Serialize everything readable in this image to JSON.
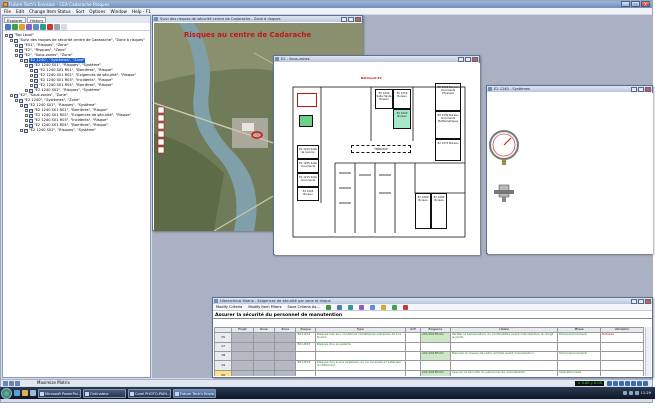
{
  "app": {
    "title": "Future Tech's Envision - CEA Cadarache Risques"
  },
  "window_controls": {
    "minimize": "_",
    "maximize": "□",
    "close": "X"
  },
  "menu": [
    "File",
    "Edit",
    "Change Item Status",
    "Sort",
    "Options",
    "Window",
    "Help - F1"
  ],
  "left_pane": {
    "tabs": [
      "Explorer",
      "History"
    ],
    "tree": [
      {
        "indent": 0,
        "text": "\"Top Level\""
      },
      {
        "indent": 1,
        "text": "\"Suivi des risques de sécurité centre de Cadarache\", \"Zone à risques\""
      },
      {
        "indent": 2,
        "text": "\"E01\", \"Risques\", \"Zone\""
      },
      {
        "indent": 2,
        "text": "\"E2\", \"Risques\", \"Zone\""
      },
      {
        "indent": 2,
        "text": "\"E2\", \"Sous-zones\", \"Zone\""
      },
      {
        "indent": 3,
        "text": "\"E2 1240\", \"Systèmes\", \"Zone\"",
        "selected": true
      },
      {
        "indent": 4,
        "text": "\"E2 1240 S01\", \"Risques\", \"Système\""
      },
      {
        "indent": 5,
        "text": "\"E2 1240 S01 R01\", \"Barrières\", \"Risque\""
      },
      {
        "indent": 5,
        "text": "\"E2 1240 S01 R02\", \"Exigences de sécurité\", \"Risque\""
      },
      {
        "indent": 5,
        "text": "\"E2 1240 S01 R03\", \"Incidents\", \"Risque\""
      },
      {
        "indent": 5,
        "text": "\"E2 1240 S01 R04\", \"Barrières\", \"Risque\""
      },
      {
        "indent": 4,
        "text": "\"E2 1240 S02\", \"Risques\", \"Système\""
      },
      {
        "indent": 1,
        "text": "\"E2\", \"Sous-zones\", \"Zone\""
      },
      {
        "indent": 2,
        "text": "\"E2 1240\", \"Systèmes\", \"Zone\""
      },
      {
        "indent": 3,
        "text": "\"E2 1240 S01\", \"Risques\", \"Système\""
      },
      {
        "indent": 4,
        "text": "\"E2 1240 S01 R01\", \"Barrières\", \"Risque\""
      },
      {
        "indent": 4,
        "text": "\"E2 1240 S01 R02\", \"Exigences de sécurité\", \"Risque\""
      },
      {
        "indent": 4,
        "text": "\"E2 1240 S01 R03\", \"Incidents\", \"Risque\""
      },
      {
        "indent": 4,
        "text": "\"E2 1240 S01 R04\", \"Barrières\", \"Risque\""
      },
      {
        "indent": 3,
        "text": "\"E2 1240 S02\", \"Risques\", \"Système\""
      }
    ]
  },
  "windows": {
    "aerial": {
      "title": "Suivi des risques de sécurité centre de Cadarache - Zone à risques",
      "overlay": "Risques au centre de Cadarache"
    },
    "plan": {
      "title": "E2 - Sous-zones",
      "label": "Bâtiment E2"
    },
    "systems": {
      "title": "E2 1240 - Systèmes"
    },
    "matrix": {
      "title": "Hierarchical Matrix - Exigences de sécurité par zone et risque",
      "toolbar": [
        "Modify Criteria",
        "Modify Item Filters",
        "Save Criteria As..."
      ],
      "heading": "Assurer la sécurité du personnel de manutention",
      "columns": [
        "",
        "Projet",
        "Zone",
        "Zone",
        "Risque",
        "Type",
        "GYP",
        "Exigence",
        "Libellé",
        "Phase",
        "Validation"
      ],
      "rows": [
        {
          "n": "15",
          "risque": "E01-R02",
          "type": "Risques liés aux conditions climatiques extrêmes et à la foudre",
          "gyp": "",
          "exig": "A01/2023Ex01",
          "lib": "Vérifier la température du combustible avant manutention au doigt je poids",
          "phase": "Dimensionnement",
          "valid": "Refusée"
        },
        {
          "n": "17",
          "risque": "E01-R03",
          "type": "Risques dus au séisme",
          "gyp": "",
          "exig": "",
          "lib": "",
          "phase": "",
          "valid": ""
        },
        {
          "n": "18",
          "risque": "",
          "type": "",
          "gyp": "",
          "exig": "A01/2023Ex01",
          "lib": "Mesurer le niveau de radio activité avant manutention",
          "phase": "Dimensionnement",
          "valid": ""
        },
        {
          "n": "19",
          "risque": "E01-R04",
          "type": "Risques dus à une explosion ou un incendie à l'extérieur du bâtiment",
          "gyp": "",
          "exig": "",
          "lib": "",
          "phase": "",
          "valid": ""
        },
        {
          "n": "20",
          "risque": "",
          "type": "",
          "gyp": "",
          "exig": "A01/2023Ex01",
          "lib": "Assurer la sécurité du personnel de manutention",
          "phase": "Opérationnelle",
          "valid": ""
        },
        {
          "n": "",
          "risque": "",
          "type": "",
          "gyp": "",
          "exig": "",
          "lib": "",
          "phase": "",
          "valid": ""
        },
        {
          "n": "21",
          "zone2": "E2 1240",
          "risque": "",
          "type": "",
          "gyp": "",
          "exig": "",
          "lib": "",
          "phase": "",
          "valid": ""
        }
      ]
    }
  },
  "plan_rooms": [
    "E2 1200 Bureau documents Physique",
    "E2 1240 Salle Haute Tension",
    "E2 1250 Bureau",
    "E2 1220 Bureau",
    "E2 1210 Salle de réunion",
    "E2 1225 Salle documents",
    "E2 1215 Salle documents",
    "E2 1205 Bureau",
    "E2 1230 Bureau documents Mathématiques",
    "E2 1270 Bureau",
    "E2 1280 Bureau",
    "E2 1290 Bureau",
    "TERRASSE"
  ],
  "statusbar": {
    "text": "Maximize Matrix",
    "coord": "< 0.00 y 0.00"
  },
  "taskbar": {
    "items": [
      "Microsoft PowerPoi...",
      "Ordinateur",
      "Corel PHOTO-PAIN...",
      "Future Tech's Envisi..."
    ],
    "clock": "11:29"
  }
}
